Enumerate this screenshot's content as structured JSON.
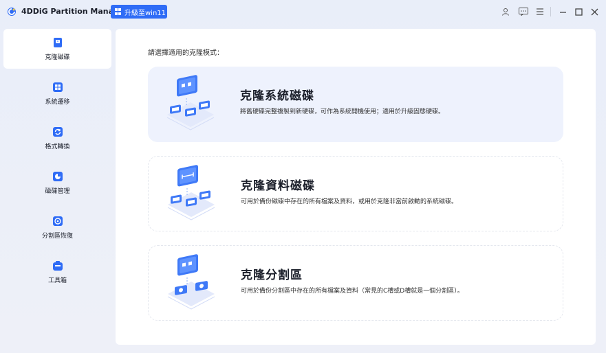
{
  "app": {
    "title": "4DDiG Partition Manager",
    "upgrade_label": "升級至win11",
    "accent_color": "#2f6cf6"
  },
  "titlebar_icons": [
    "user-icon",
    "feedback-icon",
    "menu-icon",
    "minimize-icon",
    "maximize-icon",
    "close-icon"
  ],
  "sidebar": {
    "items": [
      {
        "label": "克隆磁碟",
        "icon": "clone-disk-icon",
        "active": true
      },
      {
        "label": "系統遷移",
        "icon": "system-migrate-icon",
        "active": false
      },
      {
        "label": "格式轉換",
        "icon": "format-convert-icon",
        "active": false
      },
      {
        "label": "磁碟管理",
        "icon": "disk-manage-icon",
        "active": false
      },
      {
        "label": "分割區恢復",
        "icon": "partition-recover-icon",
        "active": false
      },
      {
        "label": "工具箱",
        "icon": "toolbox-icon",
        "active": false
      }
    ]
  },
  "main": {
    "prompt": "請選擇適用的克隆模式：",
    "cards": [
      {
        "title": "克隆系統磁碟",
        "desc": "將舊硬碟完整複製到新硬碟，可作為系統開機使用；適用於升級固態硬碟。",
        "selected": true
      },
      {
        "title": "克隆資料磁碟",
        "desc": "可用於備份磁碟中存在的所有檔案及資料，或用於克隆非當前啟動的系統磁碟。",
        "selected": false
      },
      {
        "title": "克隆分割區",
        "desc": "可用於備份分割區中存在的所有檔案及資料（常見的C槽或D槽就是一個分割區）。",
        "selected": false
      }
    ]
  }
}
